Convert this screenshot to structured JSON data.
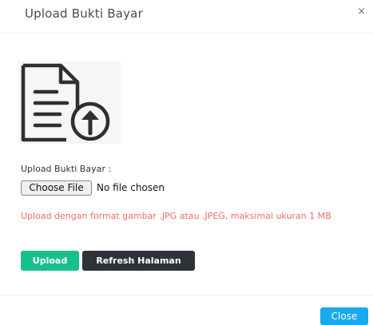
{
  "modal": {
    "title": "Upload Bukti Bayar",
    "close_icon": "×",
    "illustration_icon": "document-upload-icon"
  },
  "form": {
    "label": "Upload Bukti Bayar :",
    "choose_file_label": "Choose File",
    "file_status": "No file chosen",
    "warning": "Upload dengan format gambar .JPG atau .JPEG, maksimal ukuran 1 MB"
  },
  "actions": {
    "upload_label": "Upload",
    "refresh_label": "Refresh Halaman"
  },
  "footer": {
    "close_label": "Close"
  },
  "colors": {
    "upload_button": "#16c08a",
    "refresh_button": "#2d3339",
    "close_button": "#18a9ef",
    "warning_text": "#f26a6a"
  }
}
